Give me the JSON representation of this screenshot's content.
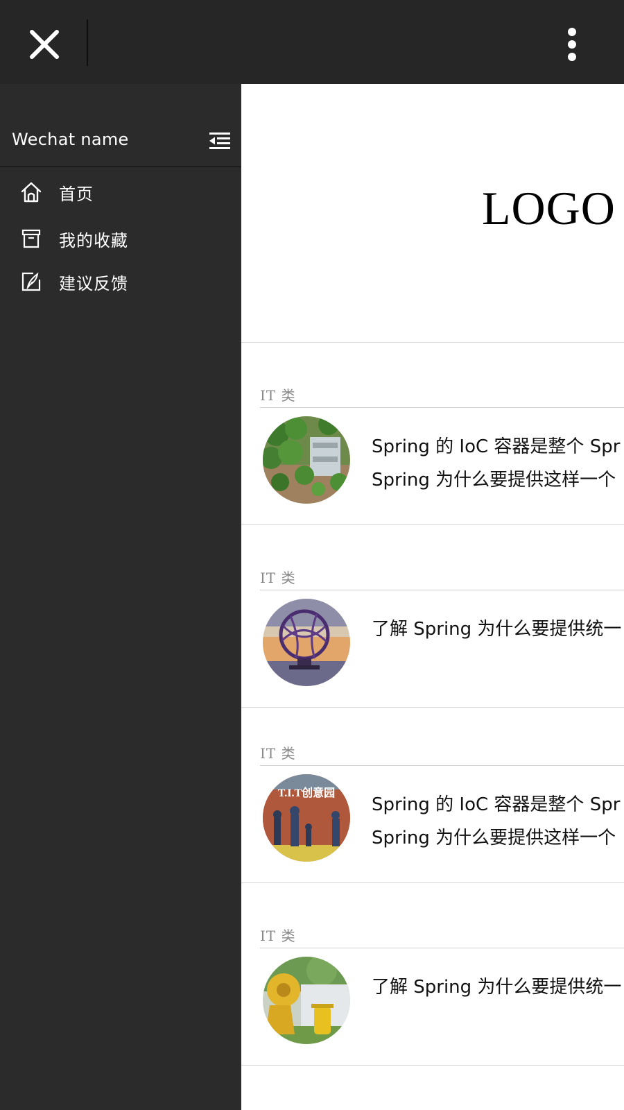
{
  "topbar": {
    "close_icon": "close-icon",
    "more_icon": "more-vertical-icon"
  },
  "sidebar": {
    "user_name": "Wechat name",
    "collapse_icon": "menu-collapse-icon",
    "items": [
      {
        "label": "首页",
        "icon": "home-icon"
      },
      {
        "label": "我的收藏",
        "icon": "archive-icon"
      },
      {
        "label": "建议反馈",
        "icon": "feedback-edit-icon"
      }
    ]
  },
  "content": {
    "logo": "LOGO",
    "articles": [
      {
        "category": "IT 类",
        "lines": [
          "Spring 的 IoC 容器是整个 Spr",
          "Spring 为什么要提供这样一个"
        ],
        "thumb": "green-ivy-wall-photo"
      },
      {
        "category": "IT 类",
        "lines": [
          "了解 Spring 为什么要提供统一"
        ],
        "thumb": "purple-wire-sculpture-photo"
      },
      {
        "category": "IT 类",
        "lines": [
          "Spring 的 IoC 容器是整个 Spr",
          "Spring 为什么要提供这样一个"
        ],
        "thumb": "tit-creative-park-photo",
        "thumb_text": "T.I.T创意园"
      },
      {
        "category": "IT 类",
        "lines": [
          "了解 Spring 为什么要提供统一"
        ],
        "thumb": "yellow-machine-sculpture-photo"
      }
    ]
  },
  "colors": {
    "topbar_bg": "#262626",
    "sidebar_bg": "#2b2b2b",
    "content_bg": "#ffffff",
    "divider": "#d6d6d6",
    "category_text": "#888888"
  }
}
